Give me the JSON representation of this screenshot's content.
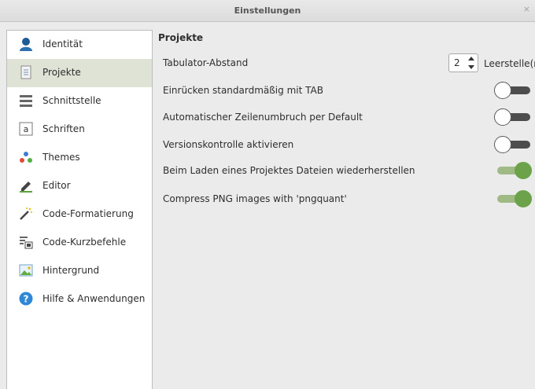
{
  "window": {
    "title": "Einstellungen",
    "close_symbol": "×"
  },
  "sidebar": {
    "items": [
      {
        "label": "Identität",
        "icon": "user-icon",
        "active": false
      },
      {
        "label": "Projekte",
        "icon": "document-icon",
        "active": true
      },
      {
        "label": "Schnittstelle",
        "icon": "menu-icon",
        "active": false
      },
      {
        "label": "Schriften",
        "icon": "font-icon",
        "active": false
      },
      {
        "label": "Themes",
        "icon": "palette-icon",
        "active": false
      },
      {
        "label": "Editor",
        "icon": "pencil-icon",
        "active": false
      },
      {
        "label": "Code-Formatierung",
        "icon": "magic-wand-icon",
        "active": false
      },
      {
        "label": "Code-Kurzbefehle",
        "icon": "snippet-icon",
        "active": false
      },
      {
        "label": "Hintergrund",
        "icon": "image-icon",
        "active": false
      },
      {
        "label": "Hilfe & Anwendungen",
        "icon": "help-icon",
        "active": false
      }
    ]
  },
  "main": {
    "section_title": "Projekte",
    "tab_spacing": {
      "label": "Tabulator-Abstand",
      "value": "2",
      "unit": "Leerstelle(n"
    },
    "toggles": [
      {
        "label": "Einrücken standardmäßig mit TAB",
        "on": false
      },
      {
        "label": "Automatischer Zeilenumbruch per Default",
        "on": false
      },
      {
        "label": "Versionskontrolle aktivieren",
        "on": false
      },
      {
        "label": "Beim Laden eines Projektes Dateien wiederherstellen",
        "on": true
      },
      {
        "label": "Compress PNG images with 'pngquant'",
        "on": true
      }
    ]
  },
  "colors": {
    "accent_green": "#6ca249",
    "active_item_bg": "#dfe3d6"
  }
}
